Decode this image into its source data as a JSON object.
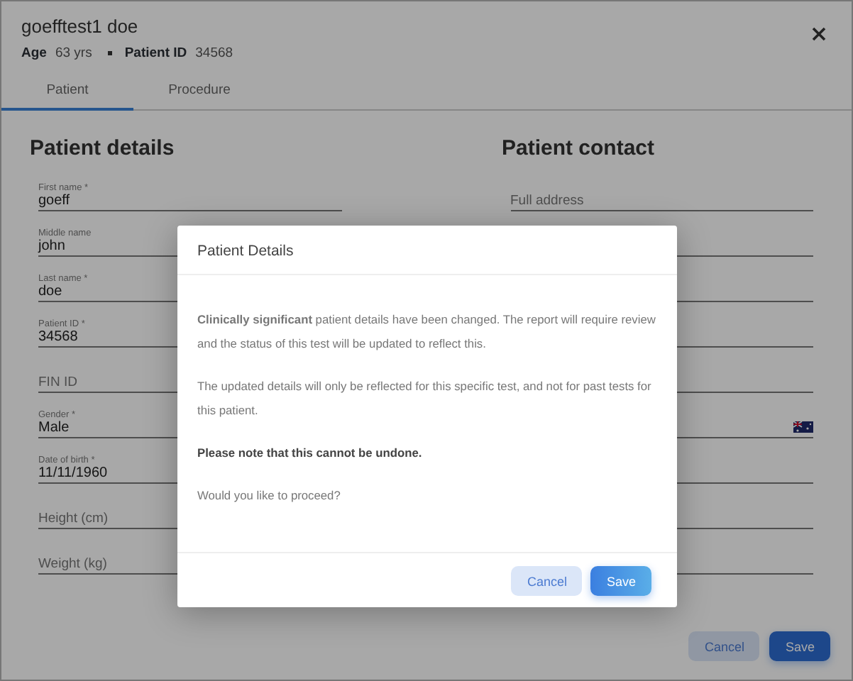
{
  "header": {
    "name": "goefftest1 doe",
    "age_label": "Age",
    "age": "63 yrs",
    "id_label": "Patient ID",
    "id": "34568"
  },
  "tabs": [
    {
      "label": "Patient",
      "selected": true
    },
    {
      "label": "Procedure",
      "selected": false
    }
  ],
  "details": {
    "title": "Patient details",
    "fields": [
      {
        "label": "First name *",
        "value": "goeff"
      },
      {
        "label": "Middle name",
        "value": "john"
      },
      {
        "label": "Last name *",
        "value": "doe"
      },
      {
        "label": "Patient ID *",
        "value": "34568"
      },
      {
        "placeholder": "FIN ID"
      },
      {
        "label": "Gender *",
        "value": "Male"
      },
      {
        "label": "Date of birth *",
        "value": "11/11/1960"
      },
      {
        "placeholder": "Height (cm)"
      },
      {
        "placeholder": "Weight (kg)"
      }
    ]
  },
  "contact": {
    "title": "Patient contact",
    "fields": [
      {
        "kind": "text",
        "placeholder": "Full address"
      },
      {
        "kind": "text"
      },
      {
        "kind": "text"
      },
      {
        "kind": "text"
      },
      {
        "kind": "text"
      },
      {
        "kind": "phone"
      },
      {
        "kind": "text"
      },
      {
        "kind": "text"
      },
      {
        "kind": "text"
      }
    ]
  },
  "footer_buttons": [
    {
      "label": "Cancel",
      "kind": "secondary"
    },
    {
      "label": "Save",
      "kind": "primary"
    }
  ],
  "modal": {
    "title": "Patient Details",
    "paragraphs": [
      {
        "text": "**Clinically significant** patient details have been changed. The report will require review and the status of this test will be updated to reflect this.",
        "kind": "normal"
      },
      {
        "text": "The updated details will only be reflected for this specific test, and not for past tests for this patient.",
        "kind": "normal"
      },
      {
        "text": "Please note that this cannot be undone.",
        "kind": "bold"
      },
      {
        "text": "Would you like to proceed?",
        "kind": "normal"
      }
    ],
    "buttons": [
      {
        "label": "Cancel",
        "kind": "secondary"
      },
      {
        "label": "Save",
        "kind": "primary"
      }
    ]
  }
}
